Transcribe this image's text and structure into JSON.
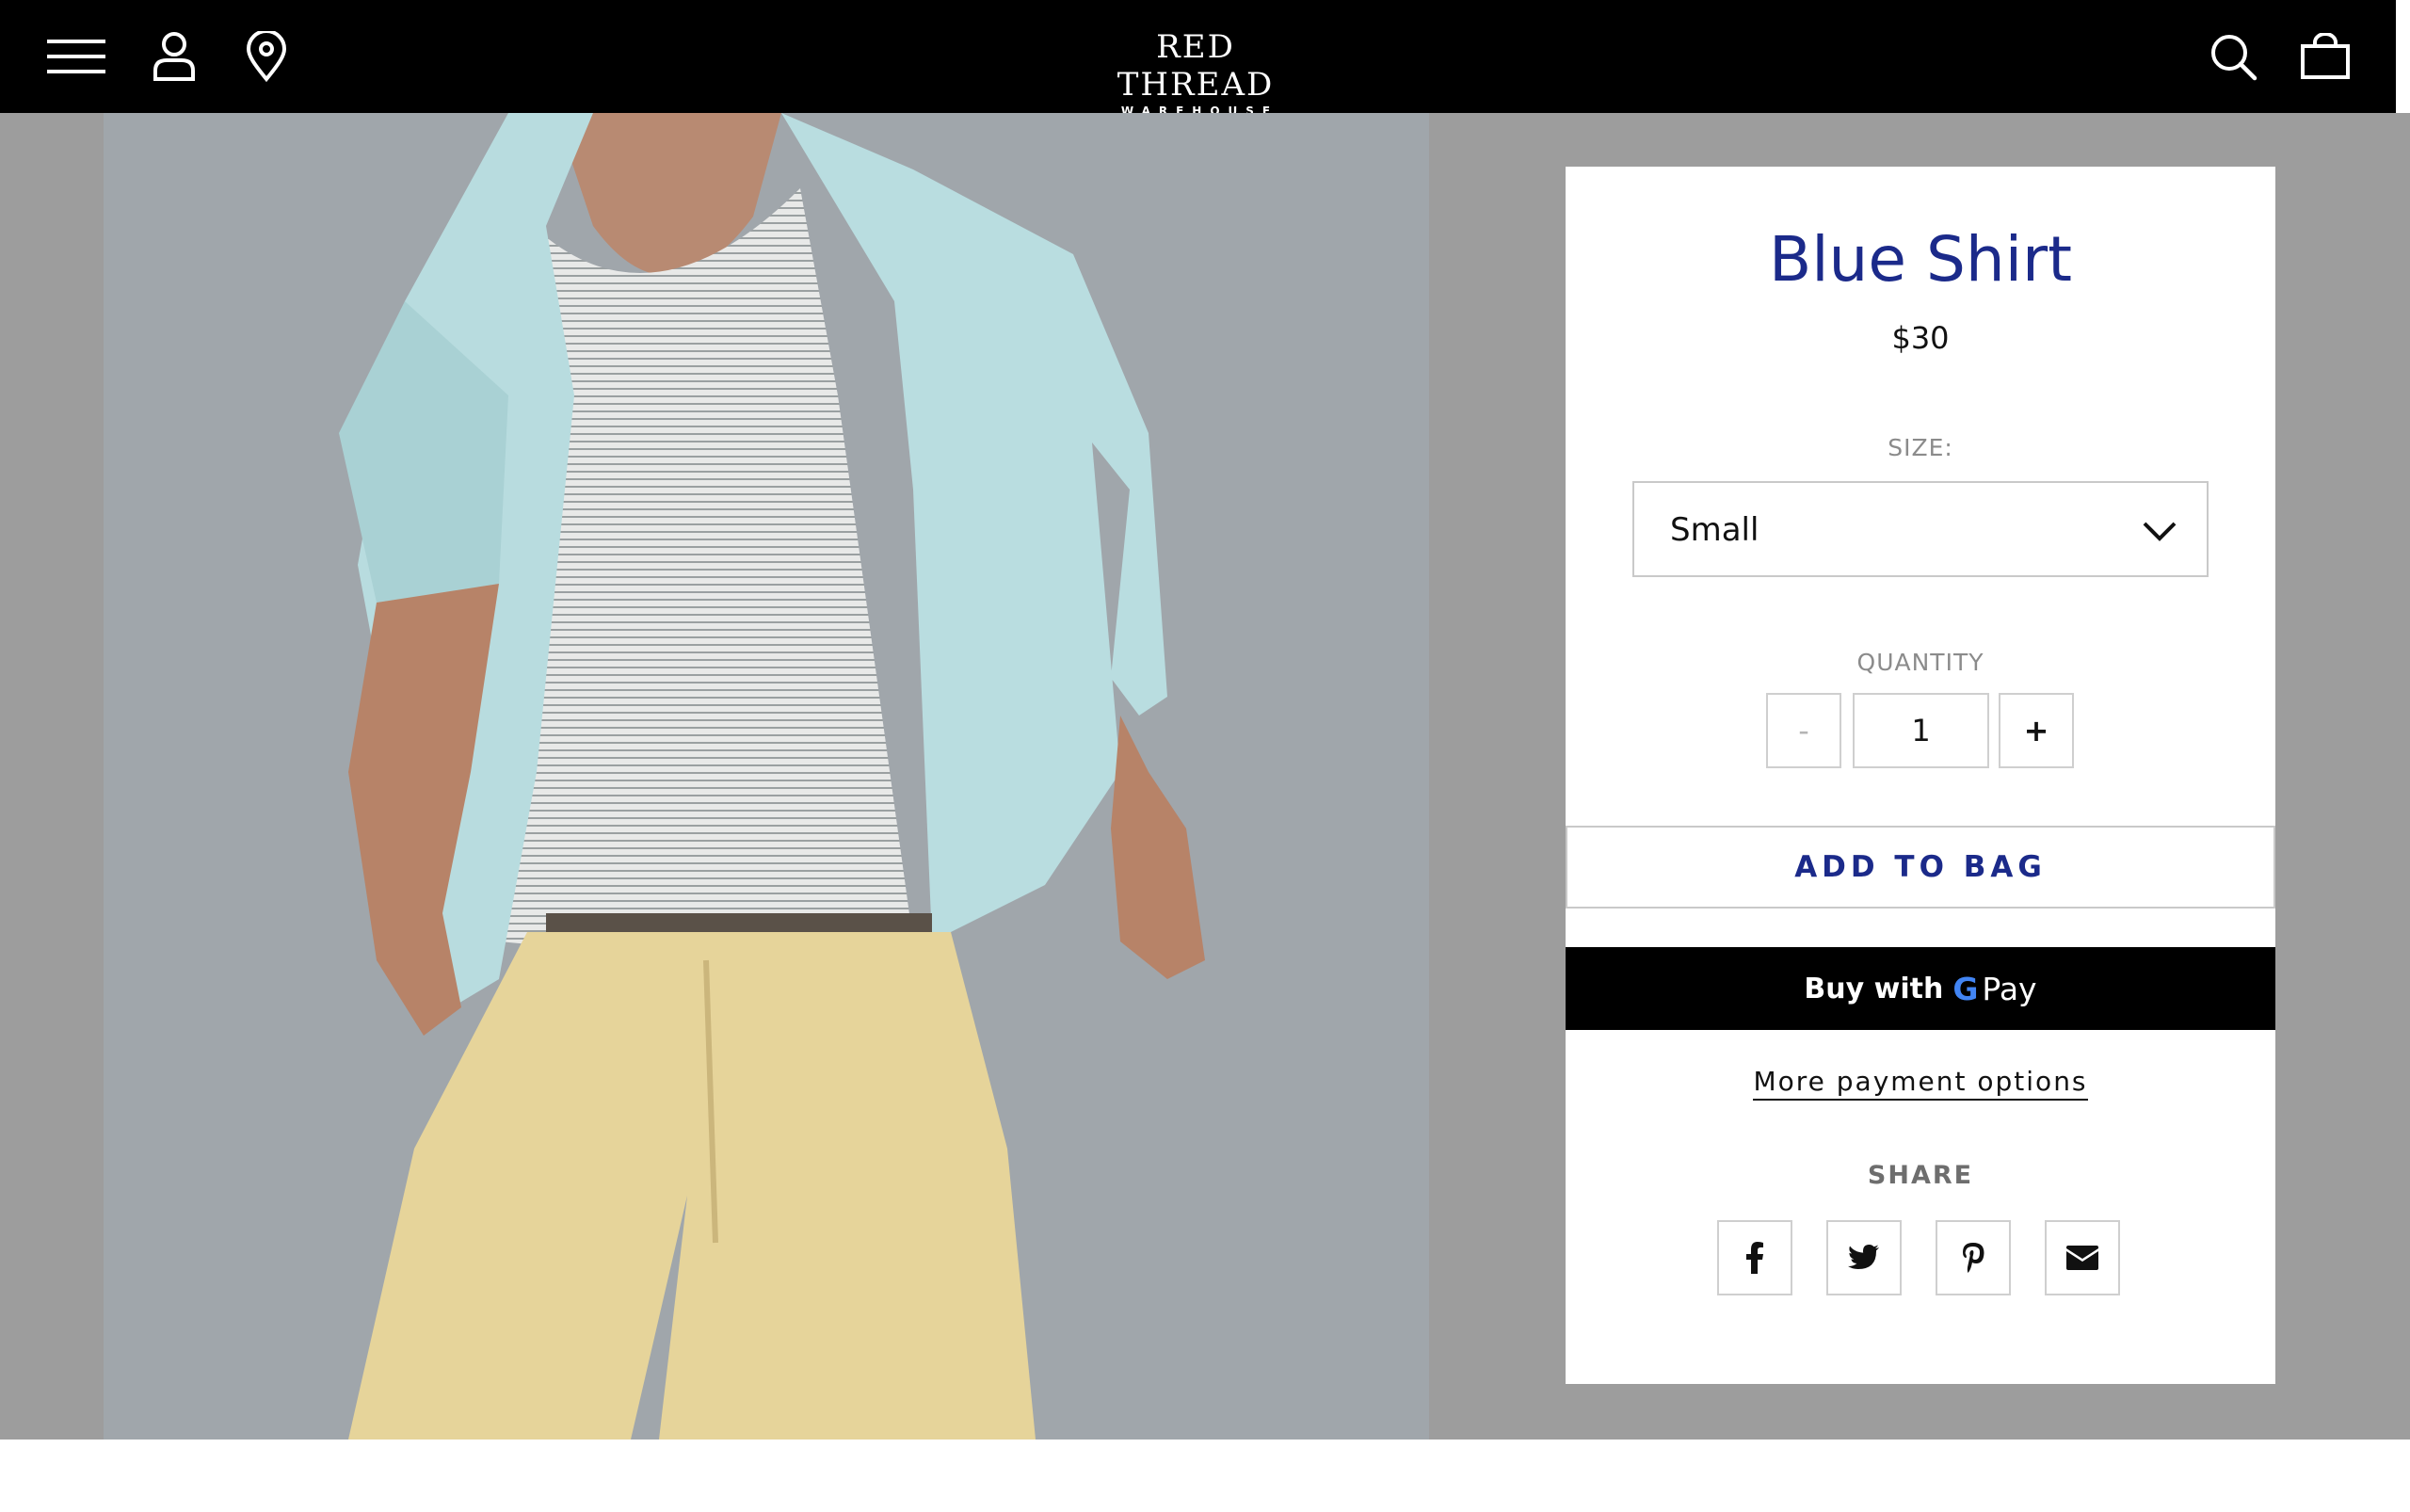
{
  "header": {
    "logo": {
      "line1": "RED THREAD",
      "line2": "WAREHOUSE"
    },
    "icons": [
      "menu-icon",
      "account-icon",
      "location-pin-icon",
      "search-icon",
      "shopping-bag-icon"
    ]
  },
  "product": {
    "title": "Blue Shirt",
    "price": "$30",
    "size_label": "SIZE:",
    "size_value": "Small",
    "quantity_label": "QUANTITY",
    "quantity_minus": "-",
    "quantity_value": "1",
    "quantity_plus": "+",
    "add_to_bag": "ADD TO BAG",
    "buy_with": "Buy with",
    "gpay_g": "G",
    "gpay_pay": "Pay",
    "more_payment": "More payment options",
    "share_label": "SHARE",
    "share_icons": [
      "facebook-icon",
      "twitter-icon",
      "pinterest-icon",
      "email-icon"
    ]
  },
  "colors": {
    "accent": "#1b2a8a",
    "header_bg": "#000000",
    "band_bg": "#9d9d9d"
  }
}
